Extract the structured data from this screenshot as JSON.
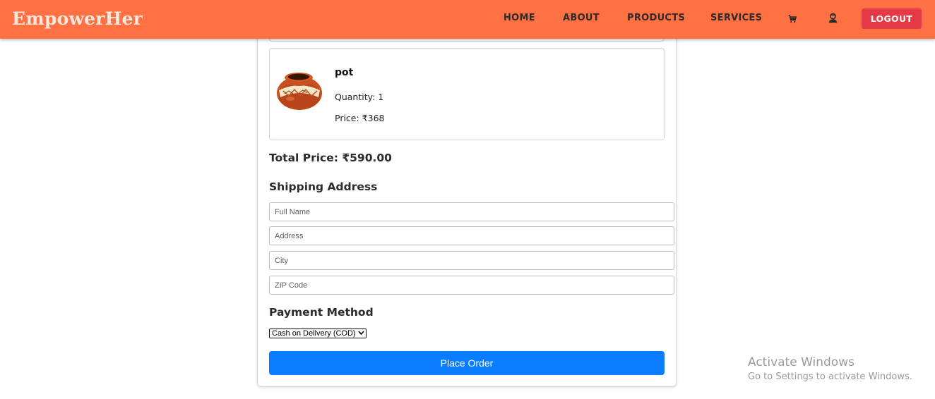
{
  "navbar": {
    "brand": "EmpowerHer",
    "links": [
      "HOME",
      "ABOUT",
      "PRODUCTS",
      "SERVICES"
    ],
    "cart_icon": "cart-icon",
    "profile_icon": "user-icon",
    "logout_label": "LOGOUT",
    "colors": {
      "bar": "#ff7043",
      "logout": "#e53946"
    }
  },
  "order": {
    "item": {
      "name": "pot",
      "quantity_text": "Quantity: 1",
      "price_text": "Price: ₹368",
      "image_icon": "pot-image"
    },
    "total_text": "Total Price: ₹590.00"
  },
  "shipping": {
    "heading": "Shipping Address",
    "fields": {
      "full_name_placeholder": "Full Name",
      "address_placeholder": "Address",
      "city_placeholder": "City",
      "zip_placeholder": "ZIP Code"
    }
  },
  "payment": {
    "heading": "Payment Method",
    "selected": "Cash on Delivery (COD)"
  },
  "place_order_label": "Place Order",
  "place_order_color": "#0a7cff",
  "watermark": {
    "line1": "Activate Windows",
    "line2": "Go to Settings to activate Windows."
  }
}
